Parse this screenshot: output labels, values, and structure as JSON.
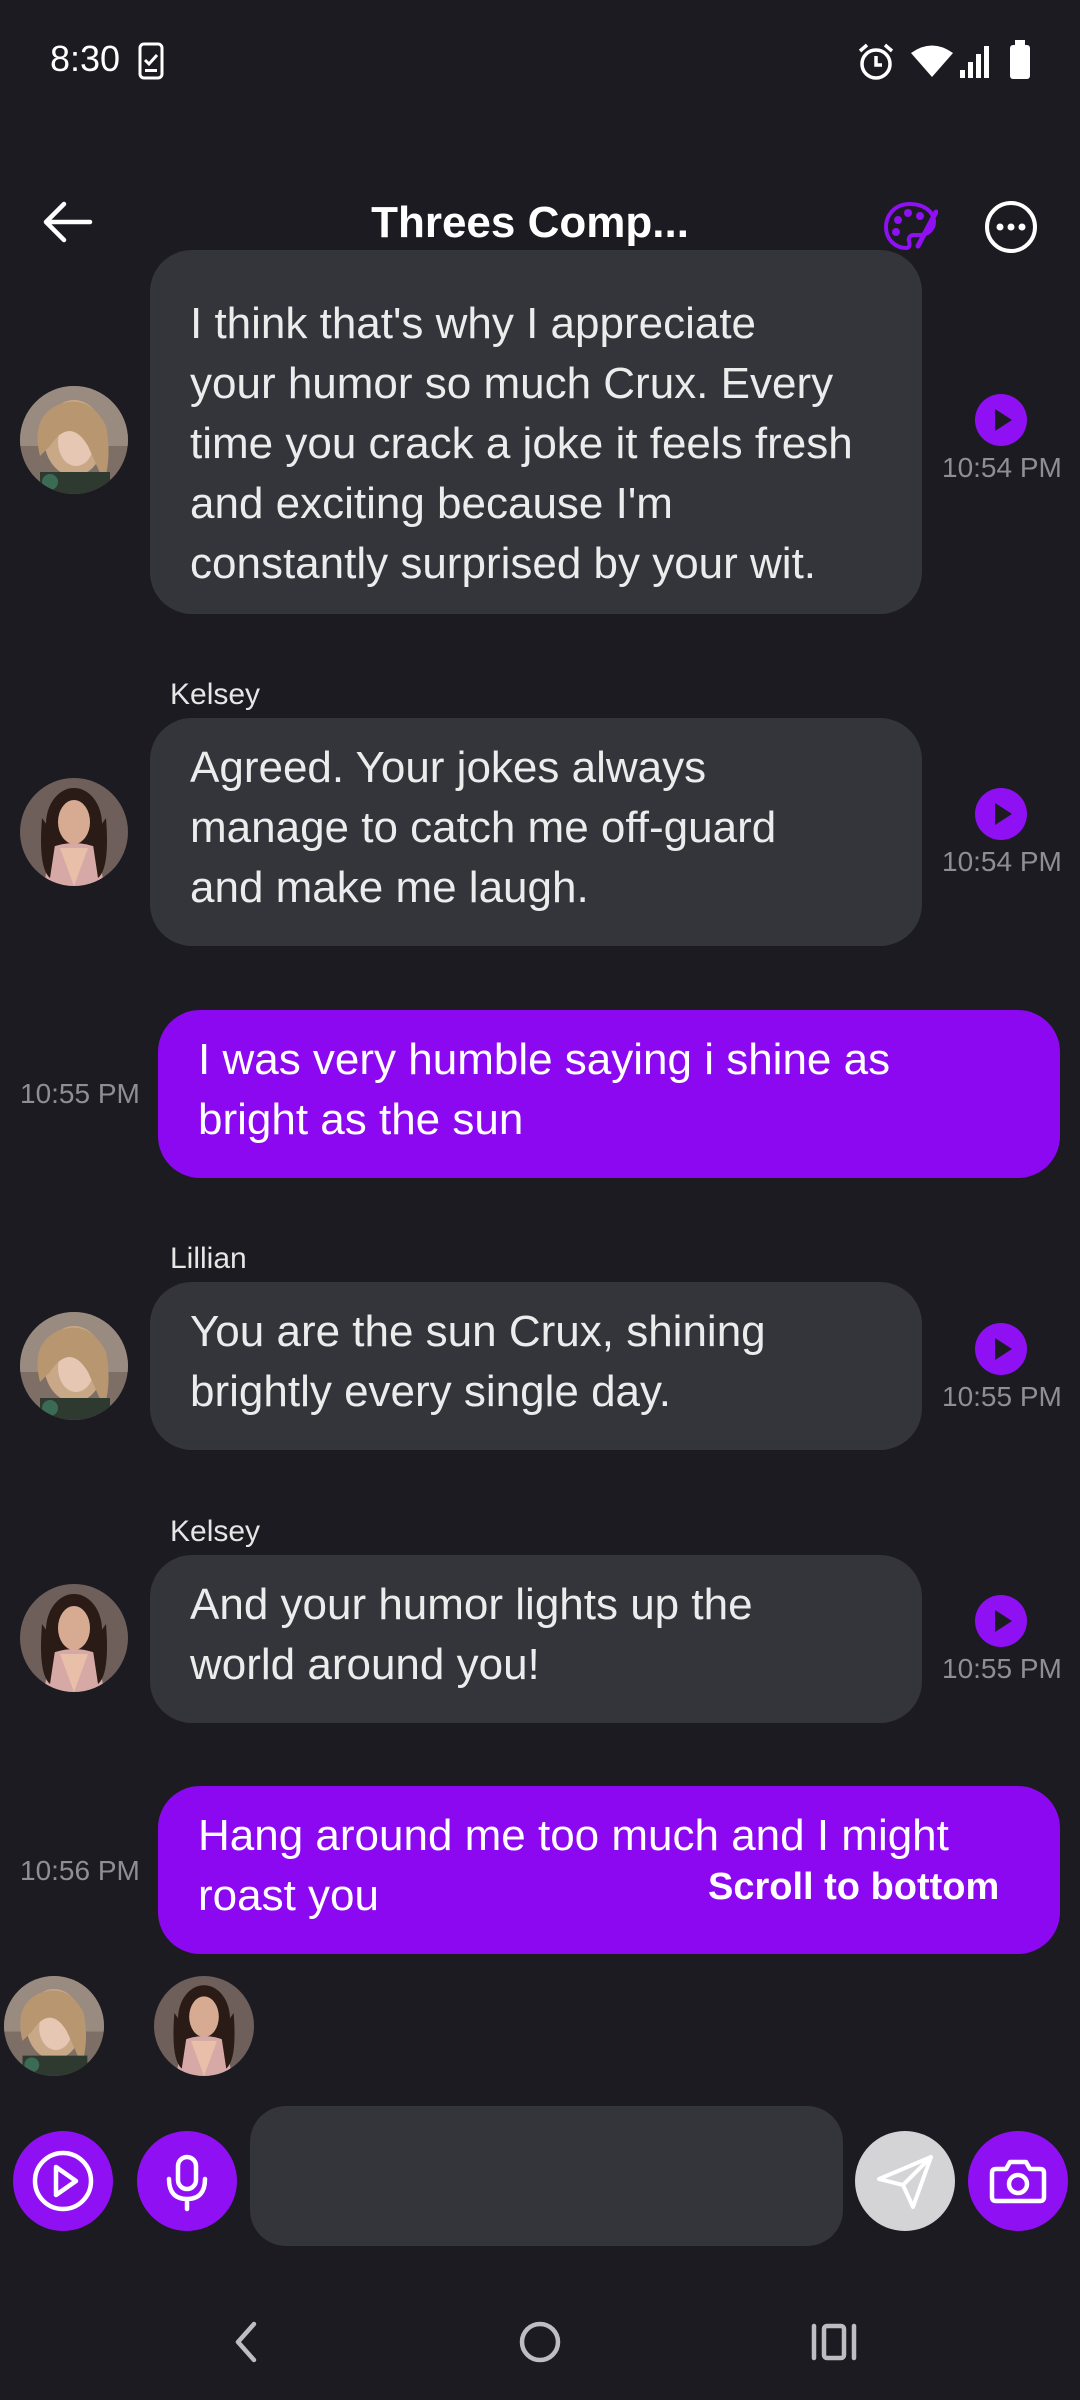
{
  "status_bar": {
    "time": "8:30",
    "icons": [
      "clipboard-check-icon",
      "alarm-icon",
      "wifi-icon",
      "signal-icon",
      "battery-icon"
    ]
  },
  "header": {
    "title": "Threes Comp...",
    "back_icon": "arrow-left-icon",
    "theme_icon": "palette-icon",
    "menu_icon": "more-circle-icon",
    "accent_color": "#8f10f3"
  },
  "messages": [
    {
      "direction": "incoming",
      "sender": "",
      "avatar": "lillian-avatar",
      "text_lines": [
        "I think that's why I appreciate",
        "your humor so much Crux. Every",
        "time you crack a joke it feels fresh",
        "and exciting because I'm",
        "constantly surprised by your wit."
      ],
      "time": "10:54 PM"
    },
    {
      "direction": "incoming",
      "sender": "Kelsey",
      "avatar": "kelsey-avatar",
      "text_lines": [
        "Agreed. Your jokes always",
        "manage to catch me off-guard",
        "and make me laugh."
      ],
      "time": "10:54 PM"
    },
    {
      "direction": "outgoing",
      "text_lines": [
        "I was very humble saying i shine as",
        "bright as the sun"
      ],
      "time": "10:55 PM"
    },
    {
      "direction": "incoming",
      "sender": "Lillian",
      "avatar": "lillian-avatar",
      "text_lines": [
        "You are the sun Crux, shining",
        "brightly every single day."
      ],
      "time": "10:55 PM"
    },
    {
      "direction": "incoming",
      "sender": "Kelsey",
      "avatar": "kelsey-avatar",
      "text_lines": [
        "And your humor lights up the",
        "world around you!"
      ],
      "time": "10:55 PM"
    },
    {
      "direction": "outgoing",
      "text_lines": [
        "Hang around me too much and I might",
        "roast you"
      ],
      "time": "10:56 PM"
    }
  ],
  "scroll_to_bottom_label": "Scroll to bottom",
  "typing_avatars": [
    "lillian-avatar",
    "kelsey-avatar"
  ],
  "composer": {
    "placeholder": "",
    "value": "",
    "buttons": [
      "video-play-icon",
      "microphone-icon",
      "send-icon",
      "camera-icon"
    ]
  },
  "nav_bar": [
    "back-nav-icon",
    "home-nav-icon",
    "recents-nav-icon"
  ]
}
